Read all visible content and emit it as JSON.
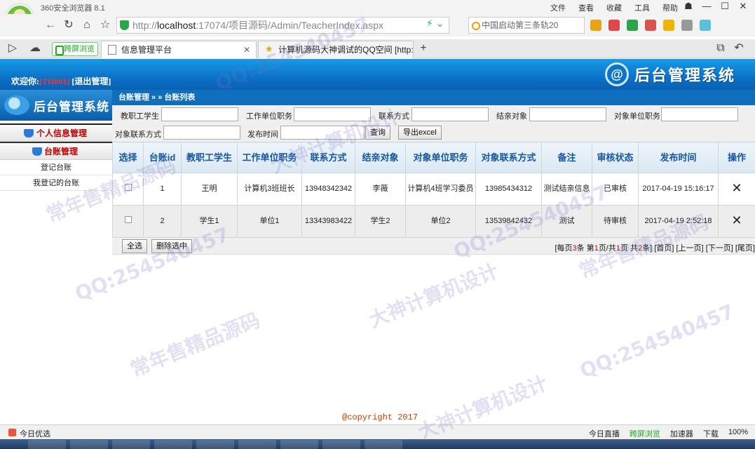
{
  "browser": {
    "name": "360安全浏览器 8.1",
    "menu": [
      "文件",
      "查看",
      "收藏",
      "工具",
      "帮助"
    ],
    "url_scheme": "http://",
    "url_host": "localhost",
    "url_rest": ":17074/项目源码/Admin/TeacherIndex.aspx",
    "search_text": "中国启动第三条轨20",
    "pill_label": "跨屏浏览",
    "tabs": [
      {
        "label": "信息管理平台"
      },
      {
        "label": "计算机源码大神调试的QQ空间 [http:"
      }
    ],
    "new_tab": "+"
  },
  "header": {
    "welcome": "欢迎你:",
    "user_id": "[TH001]",
    "logout": "[退出管理]",
    "brand_logo": "@",
    "brand_title": "后台管理系统"
  },
  "sidebar": {
    "title": "后台管理系统",
    "groups": [
      {
        "label": "个人信息管理"
      },
      {
        "label": "台账管理"
      }
    ],
    "items": [
      {
        "label": "登记台账"
      },
      {
        "label": "我登记的台账"
      }
    ]
  },
  "main": {
    "breadcrumb": "台账管理 » » 台账列表",
    "filters": {
      "teacher_student": "教职工学生",
      "work_position": "工作单位职务",
      "contact": "联系方式",
      "pair_target": "结亲对象",
      "target_position": "对象单位职务",
      "target_contact": "对象联系方式",
      "publish_time": "发布时间",
      "query_btn": "查询",
      "export_btn": "导出excel"
    },
    "table": {
      "headers": [
        "选择",
        "台账id",
        "教职工学生",
        "工作单位职务",
        "联系方式",
        "结亲对象",
        "对象单位职务",
        "对象联系方式",
        "备注",
        "审核状态",
        "发布时间",
        "操作"
      ],
      "rows": [
        {
          "id": "1",
          "person": "王明",
          "position": "计算机3班班长",
          "contact": "13948342342",
          "target": "李薇",
          "target_position": "计算机4班学习委员",
          "target_contact": "13985434312",
          "remark": "测试结亲信息",
          "status": "已审核",
          "time": "2017-04-19 15:16:17",
          "action": "✕"
        },
        {
          "id": "2",
          "person": "学生1",
          "position": "单位1",
          "contact": "13343983422",
          "target": "学生2",
          "target_position": "单位2",
          "target_contact": "13539842432",
          "remark": "测试",
          "status": "待审核",
          "time": "2017-04-19 2:52:18",
          "action": "✕"
        }
      ]
    },
    "select_all": "全选",
    "delete_selected": "删除选中",
    "pager": {
      "prefix": "[每页",
      "per_page": "3",
      "mid1": "条 第",
      "page": "1",
      "mid2": "页/共",
      "total_pages": "1",
      "mid3": "页 共",
      "total": "2",
      "suffix": "条]",
      "first": "[首页]",
      "prev": "[上一页]",
      "next": "[下一页]",
      "last": "[尾页]"
    }
  },
  "footer": {
    "copyright": "@copyright 2017"
  },
  "statusbar": {
    "left": "今日优选",
    "right": [
      "今日直播",
      "跨屏浏览",
      "加速器",
      "下载",
      "100%"
    ]
  },
  "watermarks": [
    "QQ:254540457",
    "大神计算机设计",
    "常年售精品源码",
    "QQ:254540457",
    "大神计算机设计",
    "常年售精品源码",
    "QQ:254540457",
    "QQ:254540457",
    "常年售精品源码",
    "大神计算机设计"
  ]
}
